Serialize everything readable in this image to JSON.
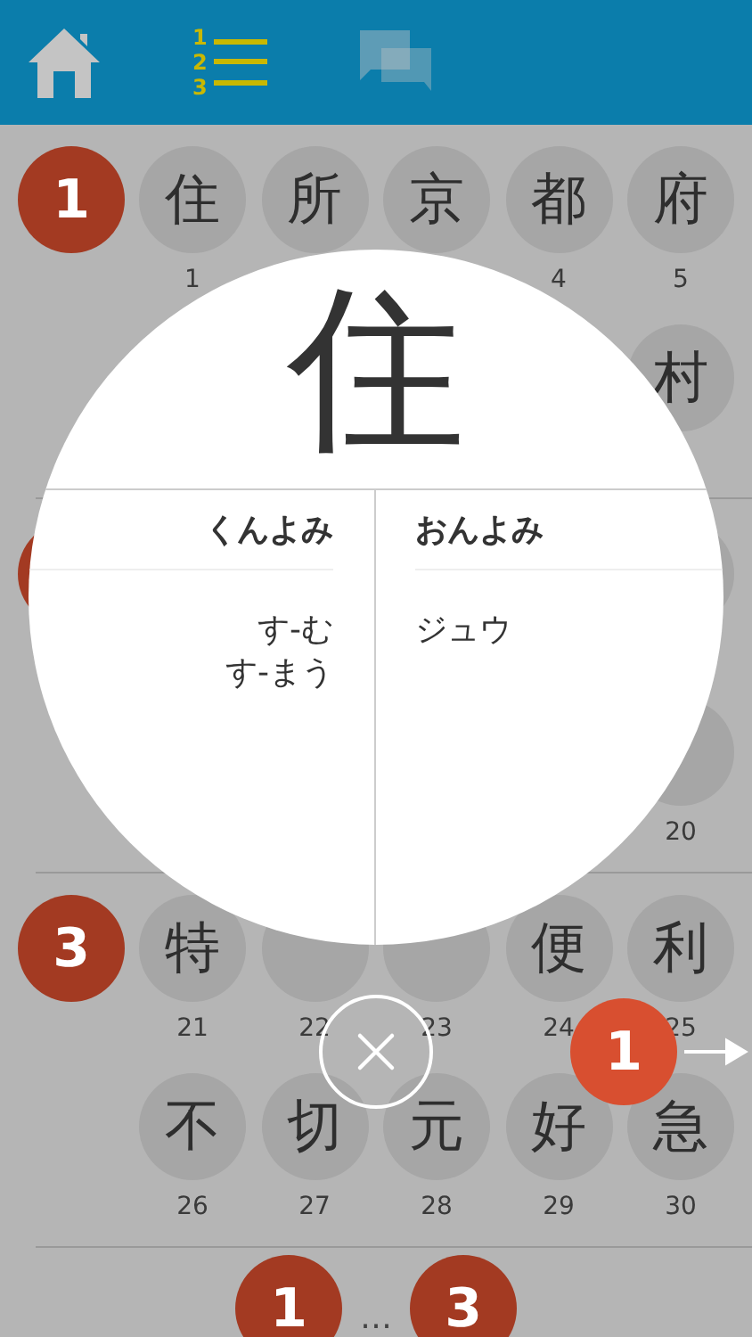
{
  "tabs": [
    {
      "kind": "home",
      "selected": false,
      "disabled": false
    },
    {
      "kind": "list",
      "selected": true,
      "disabled": false,
      "digits": [
        "1",
        "2",
        "3"
      ]
    },
    {
      "kind": "chat",
      "selected": false,
      "disabled": true
    }
  ],
  "groups": [
    {
      "badge": "1",
      "cells": [
        {
          "kanji": "住",
          "number": "1"
        },
        {
          "kanji": "所"
        },
        {
          "kanji": "京"
        },
        {
          "kanji": "都",
          "number": "4"
        },
        {
          "kanji": "府",
          "number": "5"
        },
        {},
        {},
        {},
        {},
        {
          "kanji": "村"
        }
      ]
    },
    {
      "cells": [
        {},
        {},
        {},
        {},
        {
          "kind": "blank"
        },
        {},
        {},
        {},
        {},
        {
          "number": "20"
        }
      ]
    },
    {
      "badge": "3",
      "cells": [
        {
          "kanji": "特",
          "number": "21"
        },
        {
          "number": "22"
        },
        {
          "number": "23"
        },
        {
          "kanji": "便",
          "number": "24"
        },
        {
          "kanji": "利",
          "number": "25"
        },
        {
          "kanji": "不",
          "number": "26"
        },
        {
          "kanji": "切",
          "number": "27"
        },
        {
          "kanji": "元",
          "number": "28"
        },
        {
          "kanji": "好",
          "number": "29"
        },
        {
          "kanji": "急",
          "number": "30"
        }
      ]
    }
  ],
  "pager": {
    "first": "1",
    "ellipsis": "…",
    "last": "3"
  },
  "popup": {
    "kanji": "住",
    "readings": [
      {
        "title": "くんよみ",
        "values": [
          "す-む",
          "す-まう"
        ]
      },
      {
        "title": "おんよみ",
        "values": [
          "ジュウ"
        ]
      }
    ]
  },
  "float_badge": "1"
}
